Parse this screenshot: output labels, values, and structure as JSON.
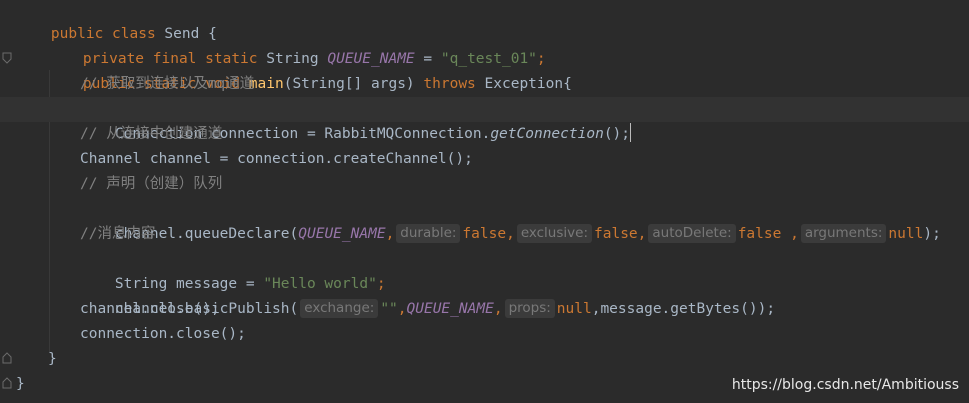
{
  "code": {
    "class_decl": {
      "kw": "public class ",
      "name": "Send {"
    },
    "field": {
      "mods": "private final static ",
      "type": "String ",
      "name": "QUEUE_NAME",
      "eq": " = ",
      "value": "\"q_test_01\"",
      "end": ";"
    },
    "main_decl": {
      "mods": "public static void ",
      "name": "main",
      "params": "(String[] args) ",
      "throws": "throws",
      "rest": " Exception{"
    },
    "comment_1": "// 获取到连接以及mq通道",
    "conn_line": {
      "lhs": "Connection connection = RabbitMQConnection.",
      "call": "getConnection",
      "end": "();"
    },
    "comment_2": "// 从连接中创建通道",
    "channel_line": "Channel channel = connection.createChannel();",
    "comment_3": "// 声明（创建）队列",
    "declare_line": {
      "prefix": "channel.queueDeclare(",
      "queue_name": "QUEUE_NAME",
      "hint_durable": "durable:",
      "val_durable": "false",
      "hint_exclusive": "exclusive:",
      "val_exclusive": "false",
      "hint_autodelete": "autoDelete:",
      "val_autodelete": "false",
      "hint_arguments": "arguments:",
      "val_arguments": "null",
      "end": ");"
    },
    "comment_4": "//消息内容",
    "message_line": {
      "lhs": "String message = ",
      "value": "\"Hello world\"",
      "end": ";"
    },
    "publish_line": {
      "prefix": "channel.basicPublish(",
      "hint_exchange": "exchange:",
      "val_exchange": "\"\"",
      "queue_name": "QUEUE_NAME",
      "hint_props": "props:",
      "val_props": "null",
      "rest": ",message.getBytes());"
    },
    "close_channel": "channel.close();",
    "close_connection": "connection.close();",
    "close_method": "}",
    "close_class": "}"
  },
  "watermark": "https://blog.csdn.net/Ambitiouss"
}
